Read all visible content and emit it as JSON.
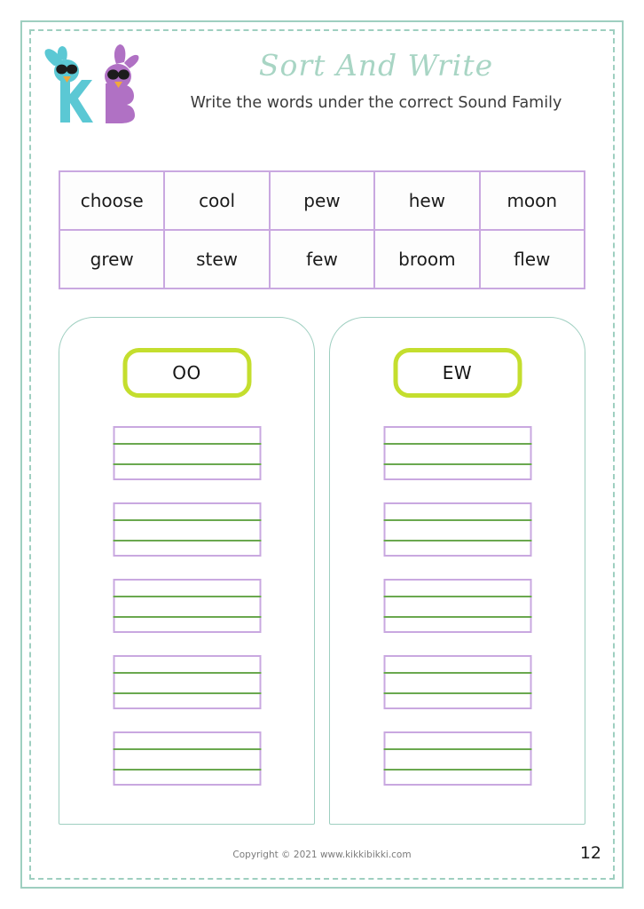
{
  "header": {
    "title": "Sort And Write",
    "subtitle": "Write the words under the correct Sound Family",
    "logo_alt": "kikkibikki-logo"
  },
  "word_bank": {
    "rows": [
      [
        "choose",
        "cool",
        "pew",
        "hew",
        "moon"
      ],
      [
        "grew",
        "stew",
        "few",
        "broom",
        "flew"
      ]
    ]
  },
  "columns": [
    {
      "category": "OO",
      "line_count": 5
    },
    {
      "category": "EW",
      "line_count": 5
    }
  ],
  "footer": {
    "copyright": "Copyright © 2021 www.kikkibikki.com",
    "page_number": "12"
  },
  "colors": {
    "frame_teal": "#9ecfc0",
    "title_teal": "#a8d5c4",
    "table_purple": "#c9a8e0",
    "badge_green": "#c4de2e",
    "line_green": "#6aa84f",
    "logo_teal": "#5bc8d4",
    "logo_purple": "#b071c4"
  }
}
